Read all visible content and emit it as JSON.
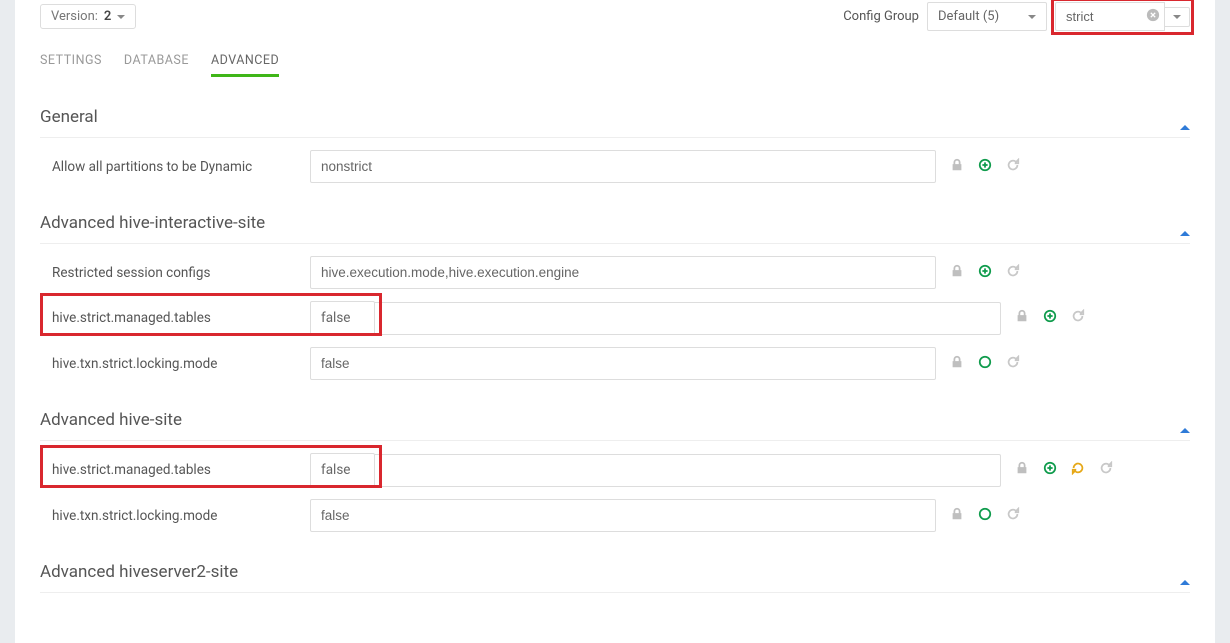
{
  "version": {
    "label": "Version:",
    "value": "2"
  },
  "config_group": {
    "label": "Config Group",
    "selected": "Default (5)"
  },
  "filter": {
    "value": "strict"
  },
  "tabs": {
    "settings": "SETTINGS",
    "database": "DATABASE",
    "advanced": "ADVANCED"
  },
  "sections": {
    "general": {
      "title": "General",
      "rows": {
        "allow_dynamic": {
          "label": "Allow all partitions to be Dynamic",
          "value": "nonstrict"
        }
      }
    },
    "adv_hive_interactive": {
      "title": "Advanced hive-interactive-site",
      "rows": {
        "restricted": {
          "label": "Restricted session configs",
          "value": "hive.execution.mode,hive.execution.engine"
        },
        "strict_managed": {
          "label": "hive.strict.managed.tables",
          "value": "false"
        },
        "txn_strict": {
          "label": "hive.txn.strict.locking.mode",
          "value": "false"
        }
      }
    },
    "adv_hive_site": {
      "title": "Advanced hive-site",
      "rows": {
        "strict_managed": {
          "label": "hive.strict.managed.tables",
          "value": "false"
        },
        "txn_strict": {
          "label": "hive.txn.strict.locking.mode",
          "value": "false"
        }
      }
    },
    "adv_hs2": {
      "title": "Advanced hiveserver2-site"
    }
  }
}
